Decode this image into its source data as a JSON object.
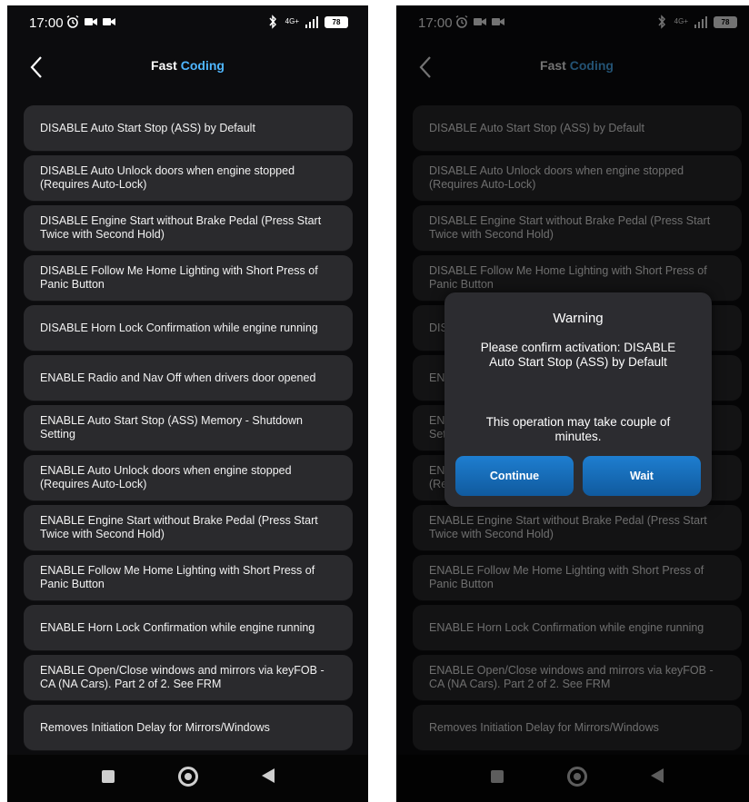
{
  "status": {
    "time": "17:00",
    "network": "4G+",
    "battery": "78"
  },
  "header": {
    "title_part1": "Fast",
    "title_part2": "Coding"
  },
  "items": [
    {
      "label": "DISABLE Auto Start Stop (ASS) by Default"
    },
    {
      "label": "DISABLE Auto Unlock doors when engine stopped (Requires Auto-Lock)"
    },
    {
      "label": "DISABLE Engine Start without Brake Pedal (Press Start Twice with Second Hold)"
    },
    {
      "label": "DISABLE Follow Me Home Lighting with Short Press of Panic Button"
    },
    {
      "label": "DISABLE Horn Lock Confirmation while engine running"
    },
    {
      "label": "ENABLE  Radio and Nav Off when drivers door opened"
    },
    {
      "label": "ENABLE Auto Start Stop (ASS) Memory - Shutdown Setting"
    },
    {
      "label": "ENABLE Auto Unlock doors when engine stopped (Requires Auto-Lock)"
    },
    {
      "label": "ENABLE Engine Start without Brake Pedal (Press Start Twice with Second Hold)"
    },
    {
      "label": "ENABLE Follow Me Home Lighting with Short Press of Panic Button"
    },
    {
      "label": "ENABLE Horn Lock Confirmation while engine running"
    },
    {
      "label": "ENABLE Open/Close windows and mirrors via keyFOB - CA (NA Cars). Part 2 of 2. See FRM"
    },
    {
      "label": "Removes Initiation Delay for Mirrors/Windows"
    }
  ],
  "dialog": {
    "title": "Warning",
    "message": "Please confirm activation: DISABLE Auto Start Stop (ASS) by Default",
    "note": "This operation may take couple of minutes.",
    "continue_label": "Continue",
    "wait_label": "Wait"
  },
  "colors": {
    "background": "#0c0c0e",
    "item_bg": "#2a2a2d",
    "accent": "#4fb6ff",
    "button": "#1a74c4"
  }
}
